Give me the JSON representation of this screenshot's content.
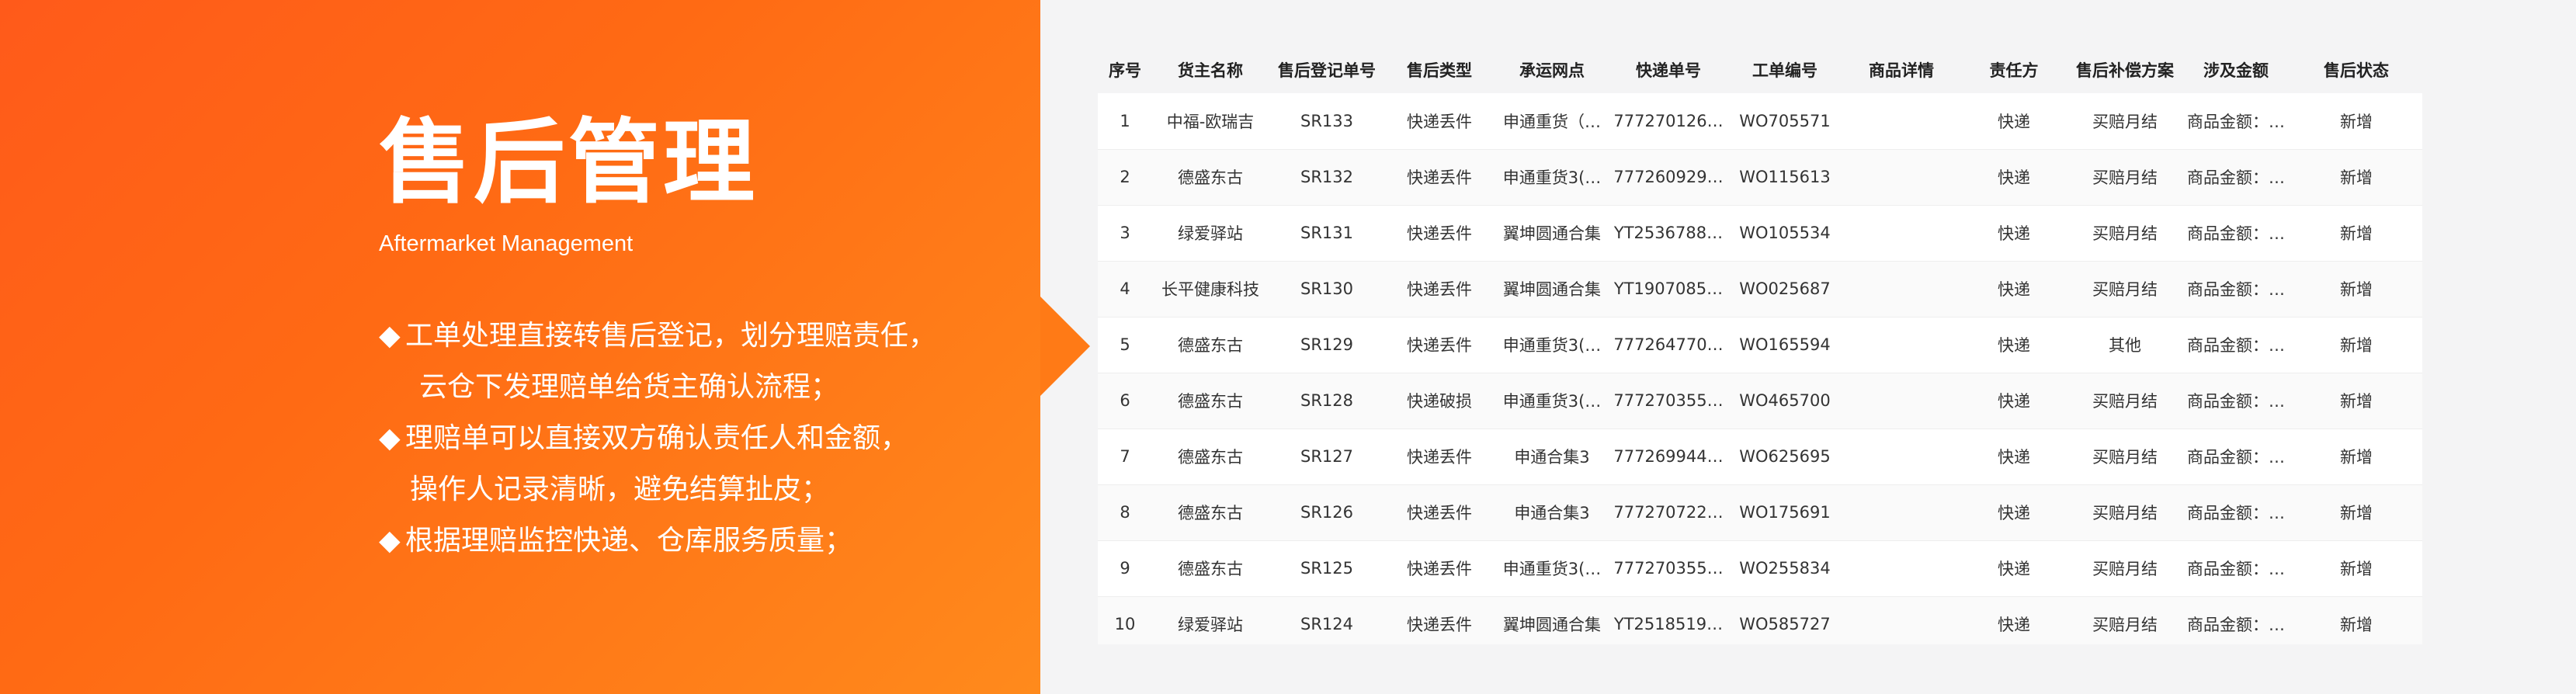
{
  "hero": {
    "title": "售后管理",
    "subtitle": "Aftermarket Management",
    "bullet_glyph": "◆",
    "bullets": [
      "工单处理直接转售后登记，划分理赔责任，",
      "云仓下发理赔单给货主确认流程；",
      "理赔单可以直接双方确认责任人和金额，",
      "操作人记录清晰，避免结算扯皮；",
      "根据理赔监控快递、仓库服务质量；"
    ]
  },
  "colors": {
    "accent": "#ff6a14",
    "background": "#f4f4f5"
  },
  "table": {
    "headers": [
      "序号",
      "货主名称",
      "售后登记单号",
      "售后类型",
      "承运网点",
      "快递单号",
      "工单编号",
      "商品详情",
      "责任方",
      "售后补偿方案",
      "涉及金额",
      "售后状态"
    ],
    "rows": [
      [
        "1",
        "中福-欧瑞吉",
        "SR133",
        "快递丢件",
        "申通重货（…",
        "777270126…",
        "WO705571",
        "",
        "快递",
        "买赔月结",
        "商品金额：…",
        "新增"
      ],
      [
        "2",
        "德盛东古",
        "SR132",
        "快递丢件",
        "申通重货3(…",
        "777260929…",
        "WO115613",
        "",
        "快递",
        "买赔月结",
        "商品金额：…",
        "新增"
      ],
      [
        "3",
        "绿爱驿站",
        "SR131",
        "快递丢件",
        "翼坤圆通合集",
        "YT2536788…",
        "WO105534",
        "",
        "快递",
        "买赔月结",
        "商品金额：…",
        "新增"
      ],
      [
        "4",
        "长平健康科技",
        "SR130",
        "快递丢件",
        "翼坤圆通合集",
        "YT1907085…",
        "WO025687",
        "",
        "快递",
        "买赔月结",
        "商品金额：…",
        "新增"
      ],
      [
        "5",
        "德盛东古",
        "SR129",
        "快递丢件",
        "申通重货3(…",
        "777264770…",
        "WO165594",
        "",
        "快递",
        "其他",
        "商品金额：…",
        "新增"
      ],
      [
        "6",
        "德盛东古",
        "SR128",
        "快递破损",
        "申通重货3(…",
        "777270355…",
        "WO465700",
        "",
        "快递",
        "买赔月结",
        "商品金额：…",
        "新增"
      ],
      [
        "7",
        "德盛东古",
        "SR127",
        "快递丢件",
        "申通合集3",
        "777269944…",
        "WO625695",
        "",
        "快递",
        "买赔月结",
        "商品金额：…",
        "新增"
      ],
      [
        "8",
        "德盛东古",
        "SR126",
        "快递丢件",
        "申通合集3",
        "777270722…",
        "WO175691",
        "",
        "快递",
        "买赔月结",
        "商品金额：…",
        "新增"
      ],
      [
        "9",
        "德盛东古",
        "SR125",
        "快递丢件",
        "申通重货3(…",
        "777270355…",
        "WO255834",
        "",
        "快递",
        "买赔月结",
        "商品金额：…",
        "新增"
      ],
      [
        "10",
        "绿爱驿站",
        "SR124",
        "快递丢件",
        "翼坤圆通合集",
        "YT2518519…",
        "WO585727",
        "",
        "快递",
        "买赔月结",
        "商品金额：…",
        "新增"
      ]
    ]
  }
}
